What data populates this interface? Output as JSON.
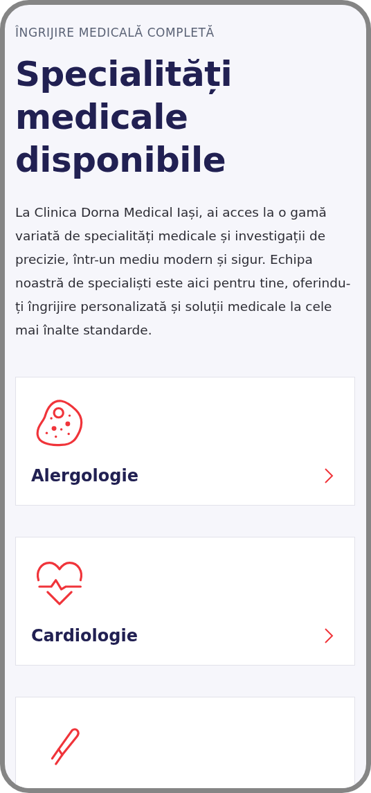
{
  "eyebrow": "ÎNGRIJIRE MEDICALĂ COMPLETĂ",
  "title": "Specialități medicale disponibile",
  "intro": "La Clinica Dorna Medical Iași, ai acces la o gamă variată de specialități medicale și investigații de precizie, într-un mediu modern și sigur. Echipa noastră de specialiști este aici pentru tine, oferindu-ți îngrijire personalizată și soluții medicale la cele mai înalte standarde.",
  "specialties": [
    {
      "kind": "cell",
      "title": "Alergologie"
    },
    {
      "kind": "heart",
      "title": "Cardiologie"
    },
    {
      "kind": "scalpel"
    }
  ]
}
